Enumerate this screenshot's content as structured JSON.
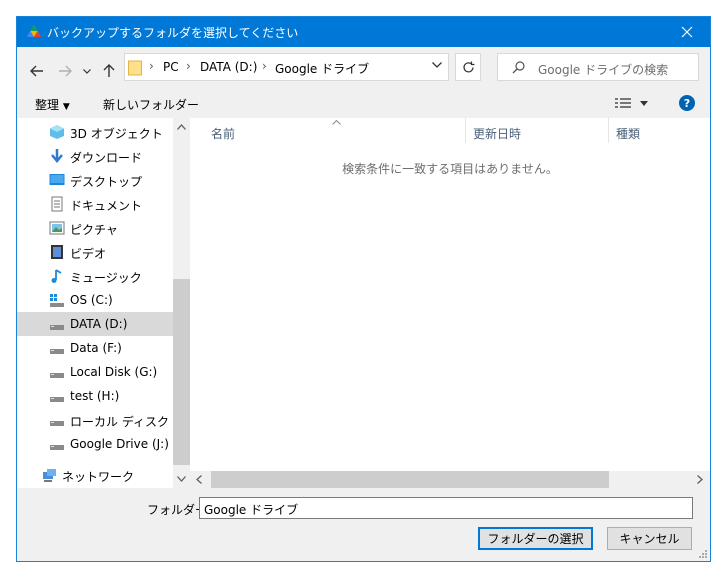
{
  "window": {
    "title": "バックアップするフォルダを選択してください"
  },
  "address": {
    "crumbs": [
      "PC",
      "DATA (D:)",
      "Google ドライブ"
    ]
  },
  "search": {
    "placeholder": "Google ドライブの検索"
  },
  "toolbar": {
    "organize": "整理",
    "new_folder": "新しいフォルダー"
  },
  "nav": {
    "items": [
      {
        "label": "3D オブジェクト",
        "icon": "3d-objects-icon"
      },
      {
        "label": "ダウンロード",
        "icon": "download-icon"
      },
      {
        "label": "デスクトップ",
        "icon": "desktop-icon"
      },
      {
        "label": "ドキュメント",
        "icon": "documents-icon"
      },
      {
        "label": "ピクチャ",
        "icon": "pictures-icon"
      },
      {
        "label": "ビデオ",
        "icon": "videos-icon"
      },
      {
        "label": "ミュージック",
        "icon": "music-icon"
      },
      {
        "label": "OS (C:)",
        "icon": "os-drive-icon"
      },
      {
        "label": "DATA (D:)",
        "icon": "drive-icon",
        "selected": true
      },
      {
        "label": "Data (F:)",
        "icon": "drive-icon"
      },
      {
        "label": "Local Disk (G:)",
        "icon": "drive-icon"
      },
      {
        "label": "test (H:)",
        "icon": "drive-icon"
      },
      {
        "label": "ローカル ディスク (I:)",
        "icon": "drive-icon"
      },
      {
        "label": "Google Drive (J:)",
        "icon": "drive-icon"
      },
      {
        "label": "ネットワーク",
        "icon": "network-icon"
      }
    ]
  },
  "columns": {
    "name": "名前",
    "modified": "更新日時",
    "type": "種類"
  },
  "content": {
    "empty_message": "検索条件に一致する項目はありません。"
  },
  "footer": {
    "folder_label": "フォルダー:",
    "folder_value": "Google ドライブ",
    "select_button": "フォルダーの選択",
    "cancel_button": "キャンセル"
  },
  "colors": {
    "titlebar": "#0078d7",
    "selected_item": "#d9d9d9",
    "accent": "#0078d7"
  }
}
